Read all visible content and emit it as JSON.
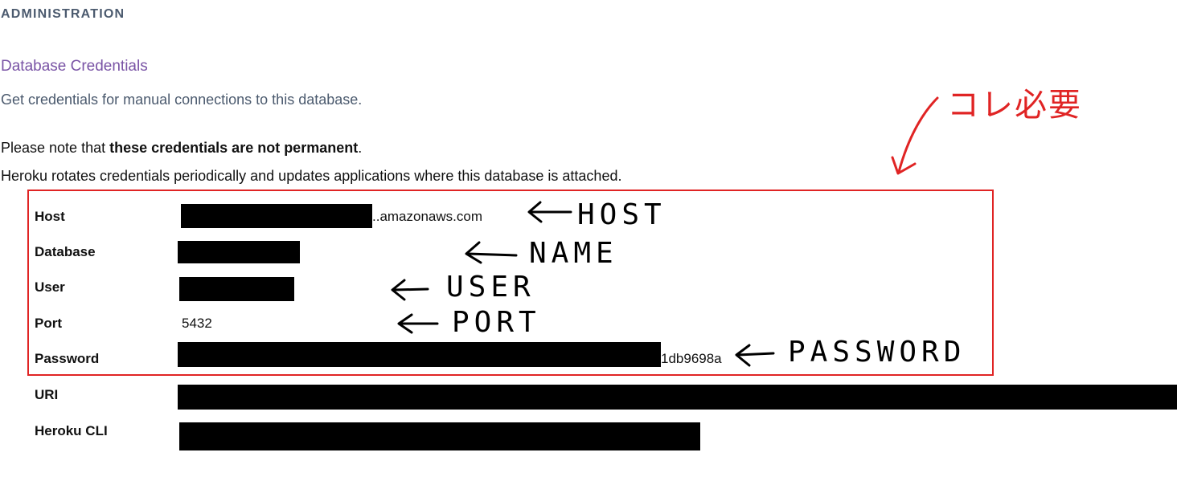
{
  "section": {
    "label": "ADMINISTRATION",
    "title": "Database Credentials",
    "description": "Get credentials for manual connections to this database."
  },
  "notice": {
    "prefix": "Please note that ",
    "emphasis": "these credentials are not permanent",
    "suffix": ".",
    "line2": "Heroku rotates credentials periodically and updates applications where this database is attached."
  },
  "credentials": {
    "host": {
      "label": "Host",
      "value_visible": "..amazonaws.com"
    },
    "database": {
      "label": "Database"
    },
    "user": {
      "label": "User"
    },
    "port": {
      "label": "Port",
      "value": "5432"
    },
    "password": {
      "label": "Password",
      "value_visible": "1db9698a"
    },
    "uri": {
      "label": "URI"
    },
    "cli": {
      "label": "Heroku CLI"
    }
  },
  "annotations": {
    "host": "HOST",
    "name": "NAME",
    "user": "USER",
    "port": "PORT",
    "password": "PASSWORD",
    "required_note": "コレ必要",
    "box_color": "#e02424"
  }
}
